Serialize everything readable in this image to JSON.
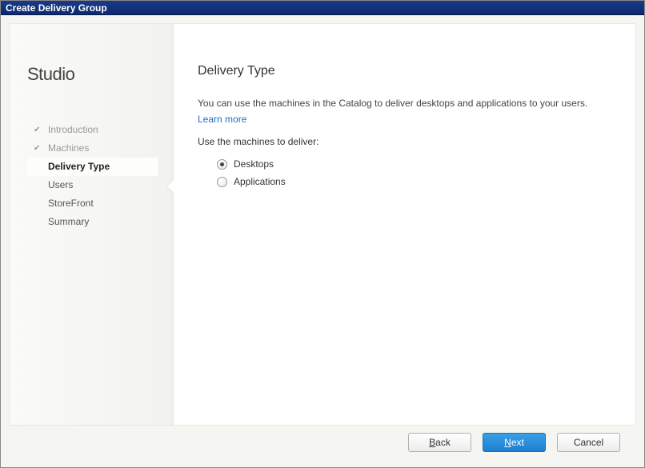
{
  "window": {
    "title": "Create Delivery Group"
  },
  "brand": "Studio",
  "steps": [
    {
      "label": "Introduction",
      "state": "done"
    },
    {
      "label": "Machines",
      "state": "done"
    },
    {
      "label": "Delivery Type",
      "state": "current"
    },
    {
      "label": "Users",
      "state": "future"
    },
    {
      "label": "StoreFront",
      "state": "future"
    },
    {
      "label": "Summary",
      "state": "future"
    }
  ],
  "page": {
    "title": "Delivery Type",
    "description": "You can use the machines in the Catalog to deliver desktops and applications to your users.",
    "learn_more": "Learn more",
    "prompt": "Use the machines to deliver:",
    "options": [
      {
        "label": "Desktops",
        "selected": true
      },
      {
        "label": "Applications",
        "selected": false
      }
    ]
  },
  "buttons": {
    "back_full": "Back",
    "next_full": "Next",
    "cancel": "Cancel",
    "back_accel": "B",
    "back_rest": "ack",
    "next_accel": "N",
    "next_rest": "ext"
  }
}
